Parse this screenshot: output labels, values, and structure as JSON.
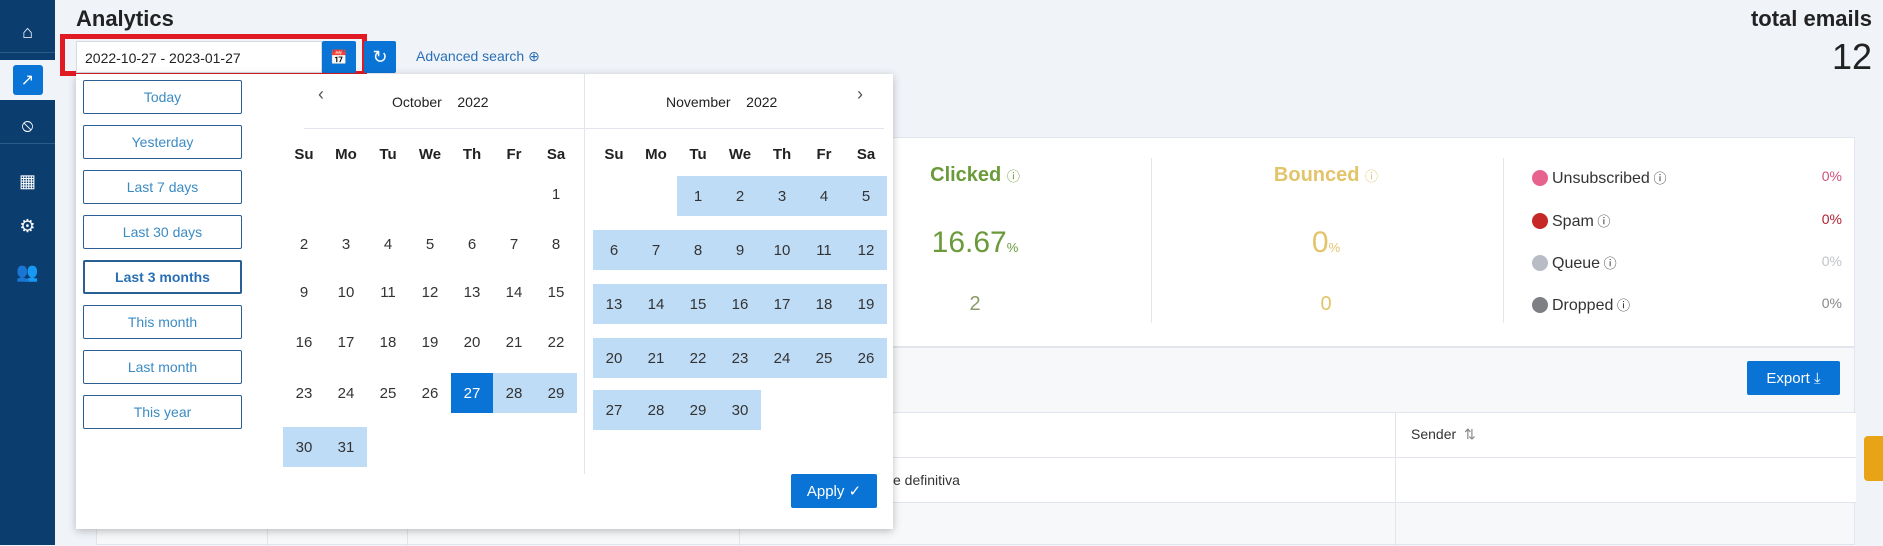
{
  "sidebar": {
    "items": [
      {
        "name": "home",
        "icon": "home-icon",
        "glyph": "⌂"
      },
      {
        "name": "analytics",
        "icon": "chart-icon",
        "glyph": "↗",
        "active": true
      },
      {
        "name": "blocked",
        "icon": "block-icon",
        "glyph": "⦸"
      },
      {
        "name": "apps",
        "icon": "grid-icon",
        "glyph": "▦"
      },
      {
        "name": "settings",
        "icon": "gear-icon",
        "glyph": "⚙"
      },
      {
        "name": "users",
        "icon": "users-icon",
        "glyph": "👥"
      }
    ]
  },
  "header": {
    "title": "Analytics",
    "date_range": "2022-10-27 - 2023-01-27",
    "advanced_search": "Advanced search",
    "total_label": "total emails",
    "total_value": "12"
  },
  "colors": {
    "accent": "#0a74d6",
    "sidebar": "#0b3d6f",
    "range": "#bfdcf6",
    "clicked": "#6a9a3a",
    "bounced": "#e2c46a",
    "unsubscribed": "#e8628e",
    "spam": "#c62828",
    "queue": "#b8bcc4",
    "dropped": "#7d7f84"
  },
  "presets": [
    "Today",
    "Yesterday",
    "Last 7 days",
    "Last 30 days",
    "Last 3 months",
    "This month",
    "Last month",
    "This year"
  ],
  "active_preset": "Last 3 months",
  "calendar": {
    "weekdays": [
      "Su",
      "Mo",
      "Tu",
      "We",
      "Th",
      "Fr",
      "Sa"
    ],
    "left": {
      "month": "October",
      "year": "2022",
      "first_weekday": 6,
      "days": 31,
      "range_start": 27
    },
    "right": {
      "month": "November",
      "year": "2022",
      "first_weekday": 2,
      "days": 30
    },
    "apply": "Apply"
  },
  "stats": {
    "clicked": {
      "title": "Clicked",
      "pct": "16.67",
      "unit": "%",
      "count": "2"
    },
    "bounced": {
      "title": "Bounced",
      "pct": "0",
      "unit": "%",
      "count": "0"
    },
    "side": [
      {
        "label": "Unsubscribed",
        "pct": "0%"
      },
      {
        "label": "Spam",
        "pct": "0%"
      },
      {
        "label": "Queue",
        "pct": "0%"
      },
      {
        "label": "Dropped",
        "pct": "0%"
      }
    ]
  },
  "table": {
    "export": "Export",
    "sender_header": "Sender",
    "row1_fragment": "e definitiva"
  }
}
